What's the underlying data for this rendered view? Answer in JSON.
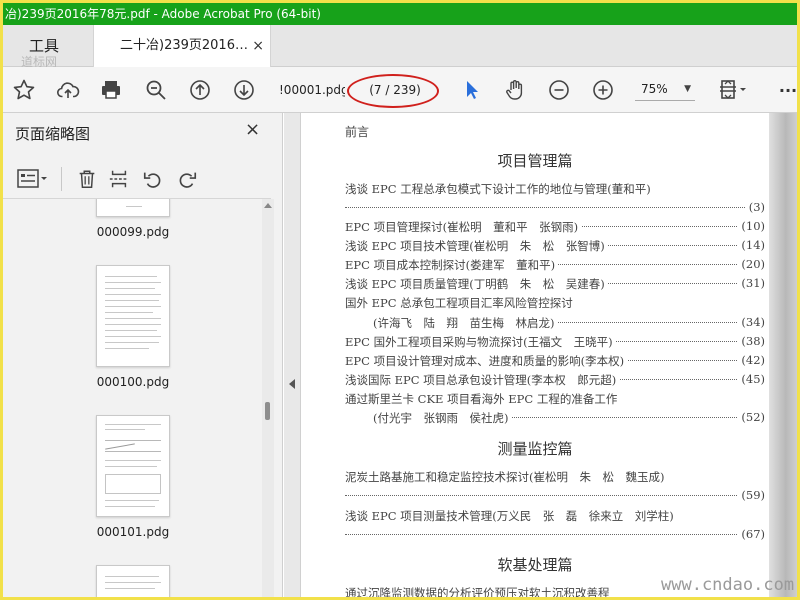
{
  "window": {
    "title": "冶)239页2016年78元.pdf - Adobe Acrobat Pro (64-bit)"
  },
  "tabs": {
    "tools_label": "工具",
    "doc_label": "二十冶)239页2016…",
    "close_glyph": "×"
  },
  "toolbar": {
    "icons": [
      "star-icon",
      "upload-cloud-icon",
      "print-icon",
      "zoom-out-search-icon",
      "page-up-icon",
      "page-down-icon",
      "select-cursor-icon",
      "hand-tool-icon",
      "zoom-out-icon",
      "zoom-in-icon",
      "fit-page-icon",
      "more-icon"
    ],
    "page_field_value": "!00001.pdg",
    "page_count": "(7 / 239)",
    "zoom_value": "75%",
    "more_glyph": "···",
    "accent_color": "#2a6fdb",
    "highlight_ring_color": "#d0201c"
  },
  "left_pane": {
    "title": "页面缩略图",
    "close_glyph": "×",
    "tool_icons": [
      "thumbnail-options-icon",
      "delete-page-icon",
      "extract-page-icon",
      "rotate-left-icon",
      "rotate-right-icon"
    ],
    "thumbnails": [
      {
        "label": "000099.pdg"
      },
      {
        "label": "000100.pdg"
      },
      {
        "label": "000101.pdg"
      },
      {
        "label": ""
      }
    ]
  },
  "document": {
    "preface": "前言",
    "sections": [
      {
        "heading": "项目管理篇",
        "entries": [
          {
            "text": "浅谈 EPC 工程总承包模式下设计工作的地位与管理(董和平)",
            "page": ""
          },
          {
            "text": "",
            "page": "(3)"
          },
          {
            "text": "EPC 项目管理探讨(崔松明　董和平　张钢雨)",
            "page": "(10)"
          },
          {
            "text": "浅谈 EPC 项目技术管理(崔松明　朱　松　张智博)",
            "page": "(14)"
          },
          {
            "text": "EPC 项目成本控制探讨(娄建军　董和平)",
            "page": "(20)"
          },
          {
            "text": "浅谈 EPC 项目质量管理(丁明鹤　朱　松　吴建春)",
            "page": "(31)"
          },
          {
            "text": "国外 EPC 总承包工程项目汇率风险管控探讨",
            "page": ""
          },
          {
            "text": "(许海飞　陆　翔　苗生梅　林启龙)",
            "page": "(34)"
          },
          {
            "text": "EPC 国外工程项目采购与物流探讨(王福文　王晓平)",
            "page": "(38)"
          },
          {
            "text": "EPC 项目设计管理对成本、进度和质量的影响(李本权)",
            "page": "(42)"
          },
          {
            "text": "浅谈国际 EPC 项目总承包设计管理(李本权　郎元超)",
            "page": "(45)"
          },
          {
            "text": "通过斯里兰卡 CKE 项目看海外 EPC 工程的准备工作",
            "page": ""
          },
          {
            "text": "(付光宇　张钢雨　侯社虎)",
            "page": "(52)"
          }
        ]
      },
      {
        "heading": "测量监控篇",
        "entries": [
          {
            "text": "泥炭土路基施工和稳定监控技术探讨(崔松明　朱　松　魏玉成)",
            "page": ""
          },
          {
            "text": "",
            "page": "(59)"
          },
          {
            "text": "浅谈 EPC 项目测量技术管理(万义民　张　磊　徐来立　刘学柱)",
            "page": ""
          },
          {
            "text": "",
            "page": "(67)"
          }
        ]
      },
      {
        "heading": "软基处理篇",
        "entries": [
          {
            "text": "通过沉降监测数据的分析评价预压对软土沉积改善程",
            "page": ""
          }
        ]
      }
    ]
  },
  "watermarks": {
    "top_left": "道标网",
    "bottom_right": "www.cndao.com"
  }
}
